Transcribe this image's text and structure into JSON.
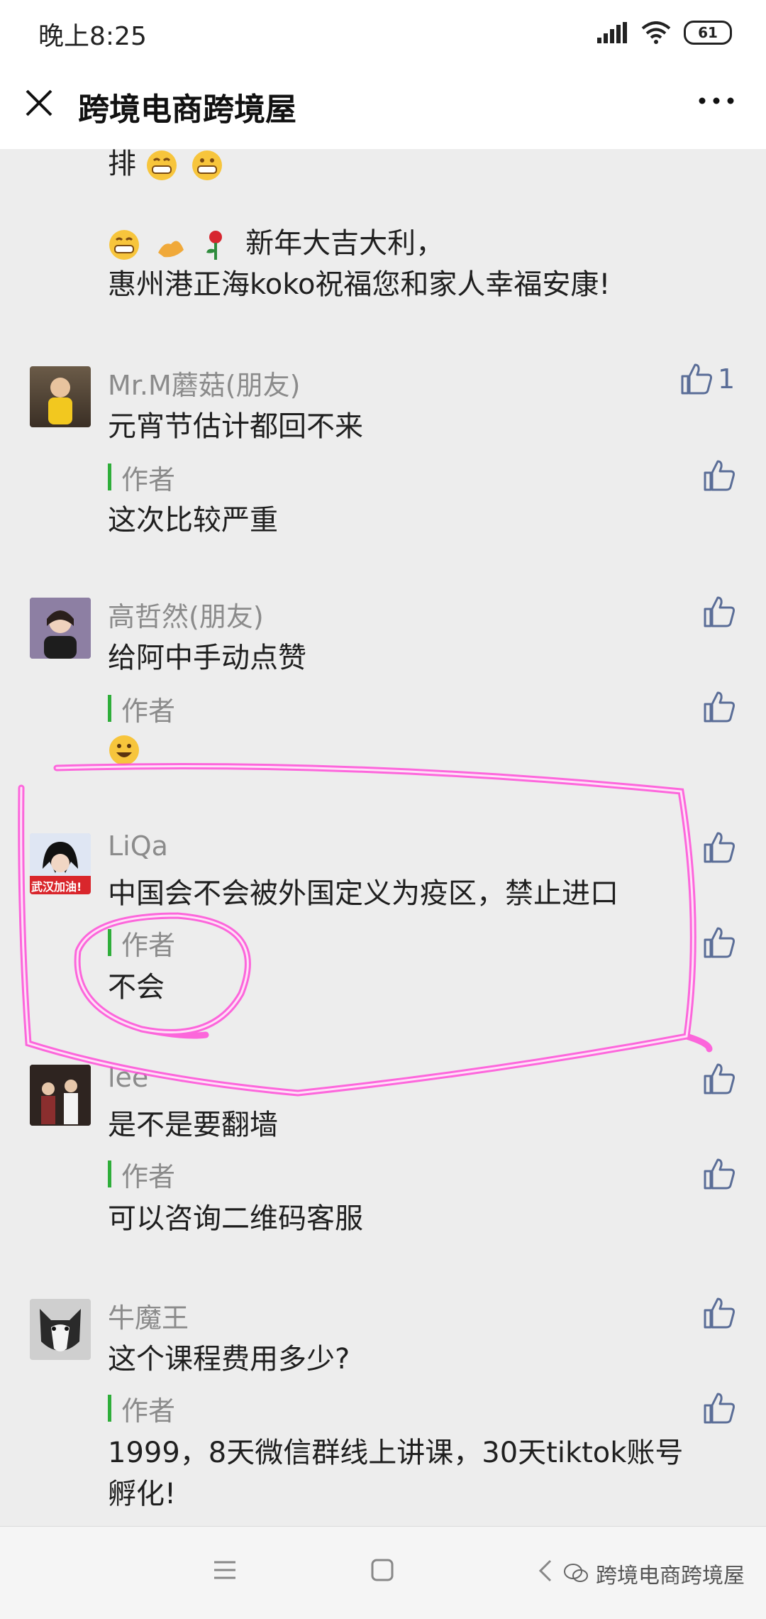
{
  "status_bar": {
    "time": "晚上8:25",
    "battery": "61"
  },
  "nav": {
    "title": "跨境电商跨境屋"
  },
  "top_post": {
    "line1_tail": "排",
    "line2": "新年大吉大利，",
    "line3": "惠州港正海koko祝福您和家人幸福安康!"
  },
  "comments": [
    {
      "name": "Mr.M蘑菇(朋友)",
      "text": "元宵节估计都回不来",
      "likes": "1",
      "reply": {
        "label": "作者",
        "text": "这次比较严重"
      }
    },
    {
      "name": "高哲然(朋友)",
      "text": "给阿中手动点赞",
      "reply": {
        "label": "作者",
        "text": ""
      }
    },
    {
      "name": "LiQa",
      "avatar_text": "武汉加油!",
      "text": "中国会不会被外国定义为疫区，禁止进口",
      "reply": {
        "label": "作者",
        "text": "不会"
      }
    },
    {
      "name": "lee",
      "text": "是不是要翻墙",
      "reply": {
        "label": "作者",
        "text": "可以咨询二维码客服"
      }
    },
    {
      "name": "牛魔王",
      "text": "这个课程费用多少?",
      "reply": {
        "label": "作者",
        "text": "1999，8天微信群线上讲课，30天tiktok账号",
        "text2": "孵化!"
      }
    }
  ],
  "watermark": "跨境电商跨境屋",
  "colors": {
    "author_bar": "#2fae3a",
    "like_icon": "#5a6d97",
    "highlight": "#ff4fd8"
  }
}
